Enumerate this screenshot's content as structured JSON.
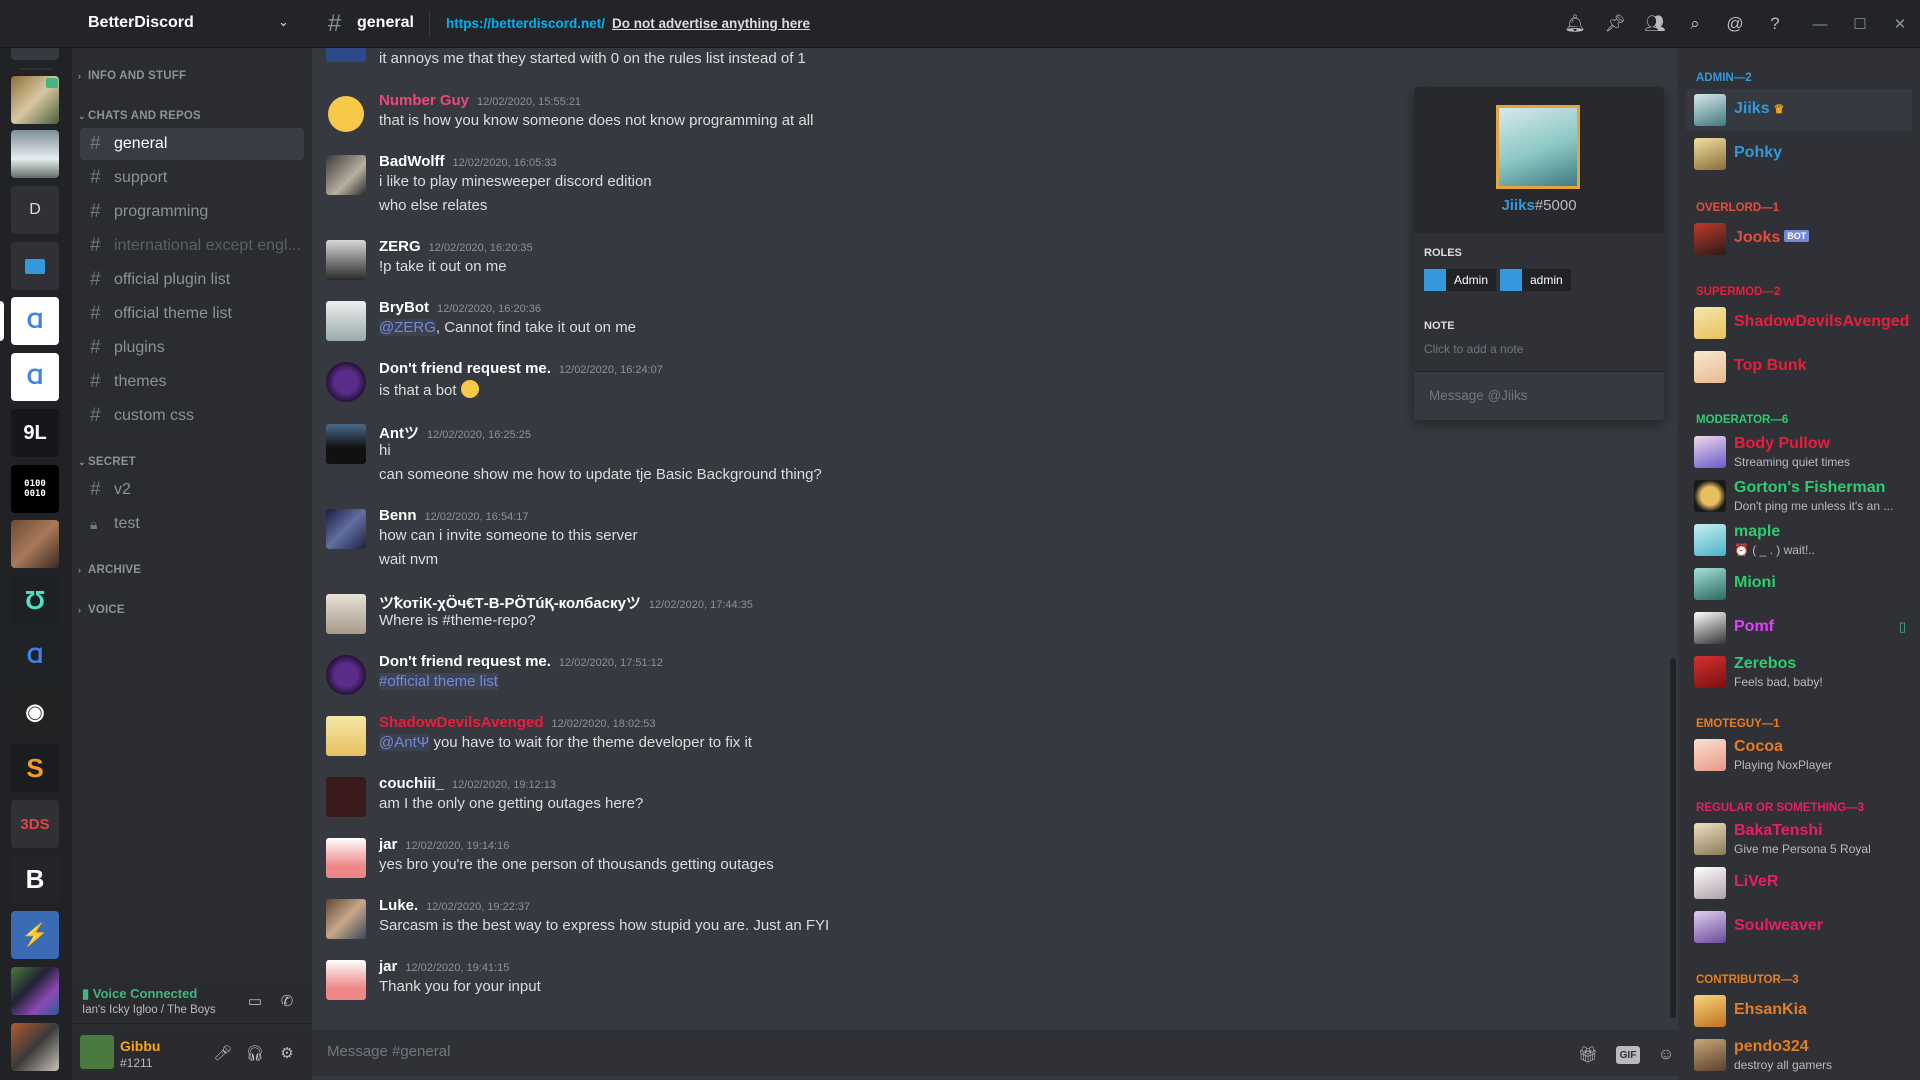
{
  "server": {
    "name": "BetterDiscord",
    "guild_letter": "D"
  },
  "header": {
    "channel": "general",
    "topic_link": "https://betterdiscord.net/",
    "topic_text": "Do not advertise anything here"
  },
  "channels": {
    "categories": {
      "info": "INFO AND STUFF",
      "chats": "CHATS AND REPOS",
      "secret": "SECRET",
      "archive": "ARCHIVE",
      "voice": "VOICE"
    },
    "items": [
      {
        "label": "general"
      },
      {
        "label": "support"
      },
      {
        "label": "programming"
      },
      {
        "label": "international except engl..."
      },
      {
        "label": "official plugin list"
      },
      {
        "label": "official theme list"
      },
      {
        "label": "plugins"
      },
      {
        "label": "themes"
      },
      {
        "label": "custom css"
      },
      {
        "label": "v2"
      },
      {
        "label": "test"
      }
    ]
  },
  "voice_panel": {
    "status": "Voice Connected",
    "channel": "Ian's Icky Igloo / The Boys"
  },
  "user_panel": {
    "name": "Gibbu",
    "tag": "#1211"
  },
  "messages": [
    {
      "author": "",
      "time": "",
      "lines": [
        "it annoys me that they started with 0 on the rules list instead of 1"
      ]
    },
    {
      "author": "Number Guy",
      "time": "12/02/2020, 15:55:21",
      "lines": [
        "that is how you know someone does not know programming at all"
      ],
      "color": "#e84a79"
    },
    {
      "author": "BadWolff",
      "time": "12/02/2020, 16:05:33",
      "lines": [
        "i like to play minesweeper discord edition",
        "who else relates"
      ]
    },
    {
      "author": "ZERG",
      "time": "12/02/2020, 16:20:35",
      "lines": [
        "!p take it out on me"
      ]
    },
    {
      "author": "BryBot",
      "time": "12/02/2020, 16:20:36",
      "mention": "@ZERG",
      "lines": [
        ", Cannot find take it out on me"
      ]
    },
    {
      "author": "Don't friend request me.",
      "time": "12/02/2020, 16:24:07",
      "lines": [
        "is that a bot"
      ]
    },
    {
      "author": "Antツ",
      "time": "12/02/2020, 16:25:25",
      "lines": [
        "hi",
        "can someone show me how to update tje Basic Background thing?"
      ]
    },
    {
      "author": "Benn",
      "time": "12/02/2020, 16:54:17",
      "lines": [
        "how can i invite someone to this server",
        "wait nvm"
      ]
    },
    {
      "author": "ツꝁотіК-χӦч€Т-В-РӦТúҚ-колбаскуツ",
      "time": "12/02/2020, 17:44:35",
      "lines": [
        "Where is #theme-repo?"
      ]
    },
    {
      "author": "Don't friend request me.",
      "time": "12/02/2020, 17:51:12",
      "channel_mention": "#official theme list",
      "lines": []
    },
    {
      "author": "ShadowDevilsAvenged",
      "time": "12/02/2020, 18:02:53",
      "mention": "@AntΨ",
      "lines": [
        " you have to wait for the theme developer to fix it"
      ],
      "color": "#e91e3c"
    },
    {
      "author": "couchiii_",
      "time": "12/02/2020, 19:12:13",
      "lines": [
        "am I the only one getting outages here?"
      ]
    },
    {
      "author": "jar",
      "time": "12/02/2020, 19:14:16",
      "lines": [
        "yes bro you're the one person of thousands getting outages"
      ]
    },
    {
      "author": "Luke.",
      "time": "12/02/2020, 19:22:37",
      "lines": [
        "Sarcasm is the best way to express how stupid you are. Just an FYI"
      ]
    },
    {
      "author": "jar",
      "time": "12/02/2020, 19:41:15",
      "lines": [
        "Thank you for your input"
      ]
    }
  ],
  "composer": {
    "placeholder": "Message #general",
    "gif": "GIF"
  },
  "popout": {
    "name": "Jiiks",
    "tag": "#5000",
    "roles_heading": "ROLES",
    "roles": [
      "Admin",
      "admin"
    ],
    "note_heading": "NOTE",
    "note_hint": "Click to add a note",
    "message_placeholder": "Message @Jiiks"
  },
  "members": {
    "groups": [
      {
        "title": "ADMIN—2",
        "color": "#3498db"
      },
      {
        "title": "OVERLORD—1",
        "color": "#e74c3c"
      },
      {
        "title": "SUPERMOD—2",
        "color": "#e91e3c"
      },
      {
        "title": "MODERATOR—6",
        "color": "#2ecc71"
      },
      {
        "title": "EMOTEGUY—1",
        "color": "#e67e22"
      },
      {
        "title": "REGULAR OR SOMETHING—3",
        "color": "#e91e63"
      },
      {
        "title": "CONTRIBUTOR—3",
        "color": "#e67e22"
      }
    ],
    "list": [
      {
        "name": "Jiiks",
        "status": "",
        "color": "#3498db"
      },
      {
        "name": "Pohky",
        "status": "",
        "color": "#3498db"
      },
      {
        "name": "Jooks",
        "status": "",
        "color": "#e74c3c",
        "bot": "BOT"
      },
      {
        "name": "ShadowDevilsAvenged",
        "status": "",
        "color": "#e91e3c"
      },
      {
        "name": "Top Bunk",
        "status": "",
        "color": "#e91e3c"
      },
      {
        "name": "Body Pullow",
        "status": "Streaming quiet times",
        "color": "#e91e3c"
      },
      {
        "name": "Gorton's Fisherman",
        "status": "Don't ping me unless it's an ...",
        "color": "#2ecc71"
      },
      {
        "name": "maple",
        "status": "⏰ ( _ . ) wait!..",
        "color": "#2ecc71"
      },
      {
        "name": "Mioni",
        "status": "",
        "color": "#2ecc71"
      },
      {
        "name": "Pomf",
        "status": "",
        "color": "#e040fb"
      },
      {
        "name": "Zerebos",
        "status": "Feels bad, baby!",
        "color": "#2ecc71"
      },
      {
        "name": "Cocoa",
        "status": "Playing NoxPlayer",
        "color": "#e67e22"
      },
      {
        "name": "BakaTenshi",
        "status": "Give me Persona 5 Royal",
        "color": "#e91e63"
      },
      {
        "name": "LiVeR",
        "status": "",
        "color": "#e91e63"
      },
      {
        "name": "Soulweaver",
        "status": "",
        "color": "#e91e63"
      },
      {
        "name": "EhsanKia",
        "status": "",
        "color": "#e67e22"
      },
      {
        "name": "pendo324",
        "status": "destroy all gamers",
        "color": "#e67e22"
      }
    ]
  }
}
